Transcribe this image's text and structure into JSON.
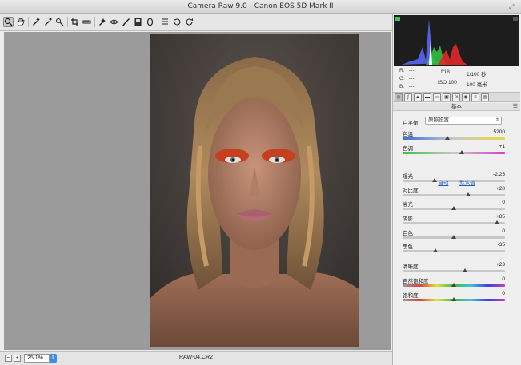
{
  "window": {
    "title": "Camera Raw 9.0 -  Canon EOS 5D Mark II"
  },
  "toolbar": {
    "tools": [
      "zoom-tool",
      "hand-tool",
      "white-balance-tool",
      "color-sampler-tool",
      "targeted-adjustment-tool",
      "crop-tool",
      "straighten-tool",
      "spot-removal-tool",
      "red-eye-removal-tool",
      "adjustment-brush-tool",
      "graduated-filter-tool",
      "radial-filter-tool",
      "preferences",
      "rotate-ccw",
      "rotate-cw"
    ]
  },
  "statusbar": {
    "zoom": "25.1%",
    "filename": "RAW-04.CR2"
  },
  "info": {
    "r_label": "R:",
    "g_label": "G:",
    "b_label": "B:",
    "r_value": "---",
    "g_value": "---",
    "b_value": "---",
    "aperture": "f/18",
    "shutter": "1/100 秒",
    "iso": "ISO 100",
    "focal": "100 毫米"
  },
  "panel": {
    "section_title": "基本",
    "wb_label": "白平衡:",
    "wb_value": "原照设置",
    "auto_link": "自动",
    "default_link": "默认值",
    "sliders": [
      {
        "label": "色温",
        "value": "5200",
        "pos": 0.44
      },
      {
        "label": "色调",
        "value": "+1",
        "pos": 0.58
      },
      {
        "label": "曝光",
        "value": "-2.25",
        "pos": 0.31
      },
      {
        "label": "对比度",
        "value": "+28",
        "pos": 0.64
      },
      {
        "label": "高光",
        "value": "0",
        "pos": 0.5
      },
      {
        "label": "阴影",
        "value": "+85",
        "pos": 0.92
      },
      {
        "label": "白色",
        "value": "0",
        "pos": 0.5
      },
      {
        "label": "黑色",
        "value": "-35",
        "pos": 0.32
      },
      {
        "label": "清晰度",
        "value": "+23",
        "pos": 0.61
      },
      {
        "label": "自然饱和度",
        "value": "0",
        "pos": 0.5
      },
      {
        "label": "饱和度",
        "value": "0",
        "pos": 0.5
      }
    ]
  },
  "colors": {
    "accent": "#3a8ee6",
    "link": "#1a5fc8",
    "canvas": "#9b9b9b"
  }
}
